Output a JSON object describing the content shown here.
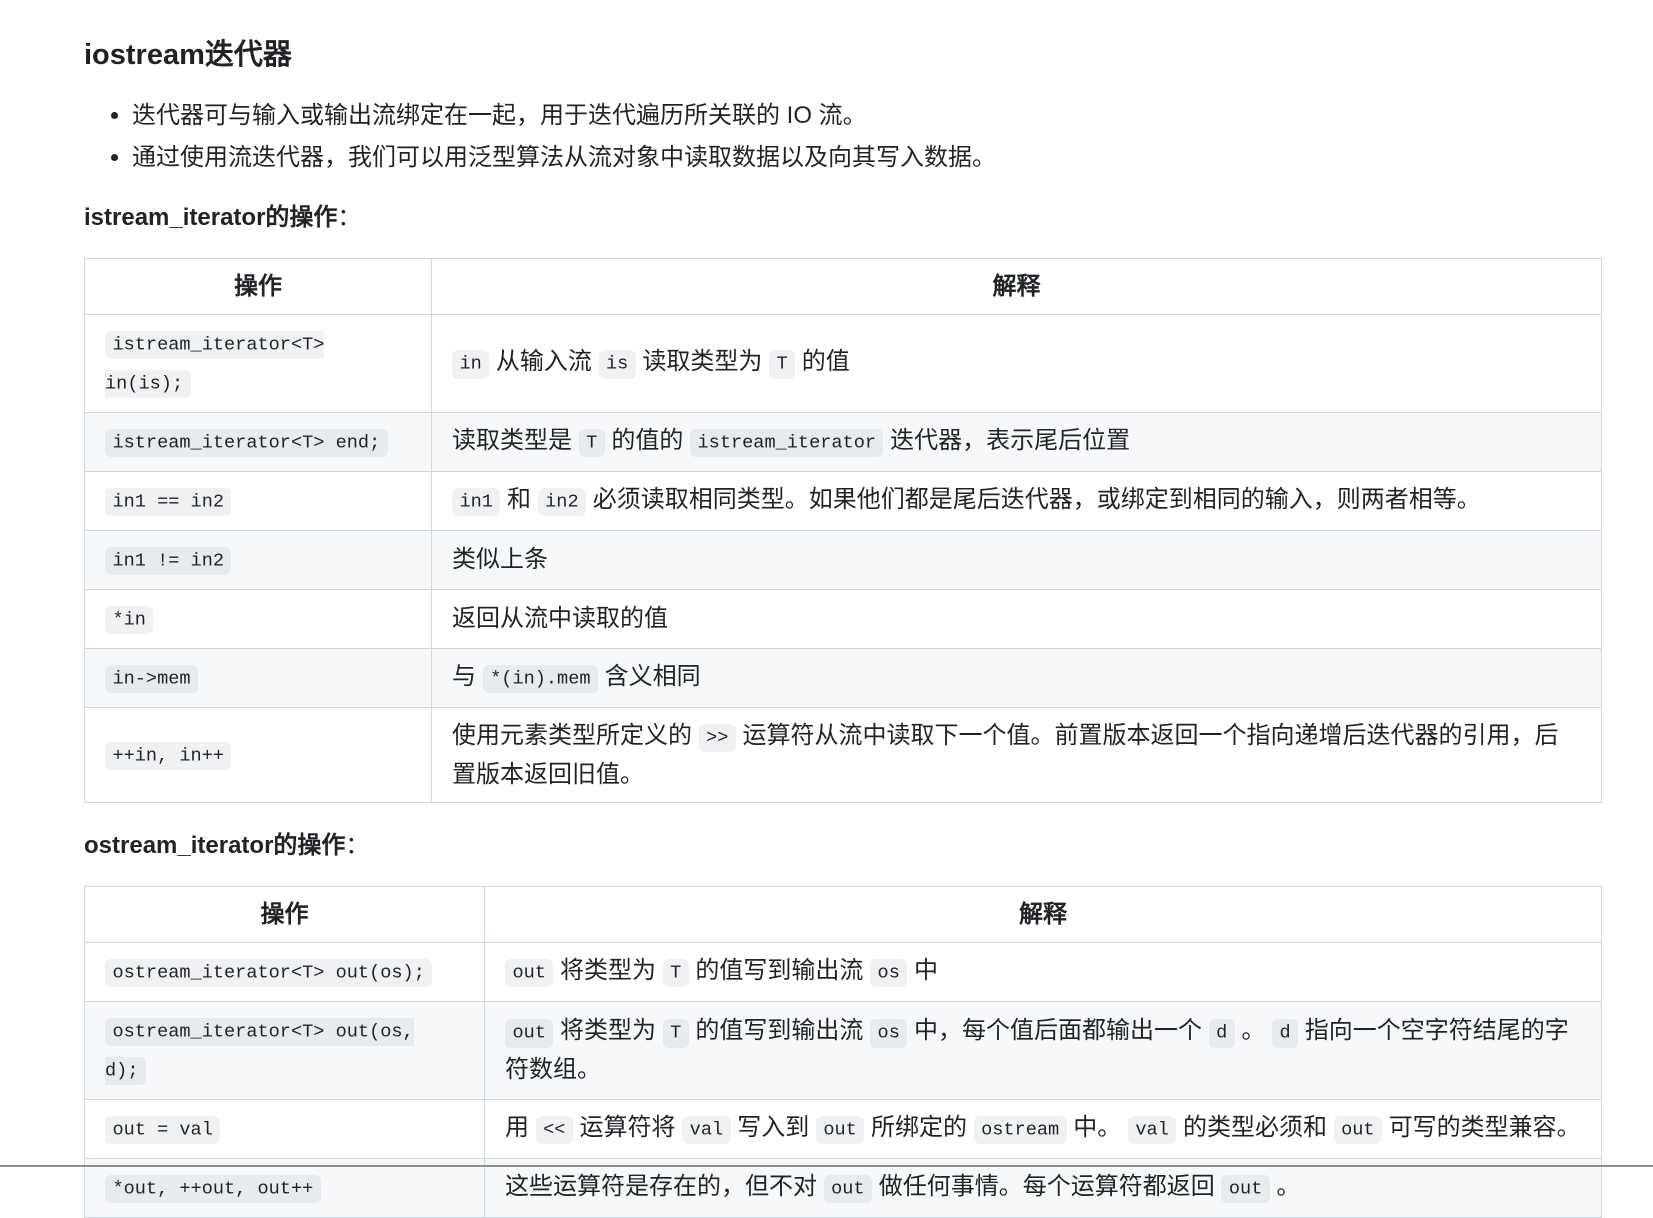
{
  "heading": "iostream迭代器",
  "bullets": [
    "迭代器可与输入或输出流绑定在一起，用于迭代遍历所关联的 IO 流。",
    "通过使用流迭代器，我们可以用泛型算法从流对象中读取数据以及向其写入数据。"
  ],
  "istream_section": {
    "title": "istream_iterator的操作",
    "title_suffix": "：",
    "headers": [
      "操作",
      "解释"
    ],
    "rows": [
      {
        "op": [
          {
            "code": "istream_iterator<T> in(is);"
          }
        ],
        "desc": [
          {
            "code": "in"
          },
          {
            "text": " 从输入流 "
          },
          {
            "code": "is"
          },
          {
            "text": " 读取类型为 "
          },
          {
            "code": "T"
          },
          {
            "text": " 的值"
          }
        ]
      },
      {
        "op": [
          {
            "code": "istream_iterator<T> end;"
          }
        ],
        "desc": [
          {
            "text": "读取类型是 "
          },
          {
            "code": "T"
          },
          {
            "text": " 的值的 "
          },
          {
            "code": "istream_iterator"
          },
          {
            "text": " 迭代器，表示尾后位置"
          }
        ]
      },
      {
        "op": [
          {
            "code": "in1 == in2"
          }
        ],
        "desc": [
          {
            "code": "in1"
          },
          {
            "text": " 和 "
          },
          {
            "code": "in2"
          },
          {
            "text": " 必须读取相同类型。如果他们都是尾后迭代器，或绑定到相同的输入，则两者相等。"
          }
        ]
      },
      {
        "op": [
          {
            "code": "in1 != in2"
          }
        ],
        "desc": [
          {
            "text": "类似上条"
          }
        ]
      },
      {
        "op": [
          {
            "code": "*in"
          }
        ],
        "desc": [
          {
            "text": "返回从流中读取的值"
          }
        ]
      },
      {
        "op": [
          {
            "code": "in->mem"
          }
        ],
        "desc": [
          {
            "text": "与 "
          },
          {
            "code": "*(in).mem"
          },
          {
            "text": " 含义相同"
          }
        ]
      },
      {
        "op": [
          {
            "code": "++in, in++"
          }
        ],
        "desc": [
          {
            "text": "使用元素类型所定义的 "
          },
          {
            "code": ">>"
          },
          {
            "text": " 运算符从流中读取下一个值。前置版本返回一个指向递增后迭代器的引用，后置版本返回旧值。"
          }
        ]
      }
    ]
  },
  "ostream_section": {
    "title": "ostream_iterator的操作",
    "title_suffix": "：",
    "headers": [
      "操作",
      "解释"
    ],
    "rows": [
      {
        "op": [
          {
            "code": "ostream_iterator<T> out(os);"
          }
        ],
        "desc": [
          {
            "code": "out"
          },
          {
            "text": " 将类型为 "
          },
          {
            "code": "T"
          },
          {
            "text": " 的值写到输出流 "
          },
          {
            "code": "os"
          },
          {
            "text": " 中"
          }
        ]
      },
      {
        "op": [
          {
            "code": "ostream_iterator<T> out(os, d);"
          }
        ],
        "desc": [
          {
            "code": "out"
          },
          {
            "text": " 将类型为 "
          },
          {
            "code": "T"
          },
          {
            "text": " 的值写到输出流 "
          },
          {
            "code": "os"
          },
          {
            "text": " 中，每个值后面都输出一个 "
          },
          {
            "code": "d"
          },
          {
            "text": " 。 "
          },
          {
            "code": "d"
          },
          {
            "text": " 指向一个空字符结尾的字符数组。"
          }
        ]
      },
      {
        "op": [
          {
            "code": "out = val"
          }
        ],
        "desc": [
          {
            "text": "用 "
          },
          {
            "code": "<<"
          },
          {
            "text": " 运算符将 "
          },
          {
            "code": "val"
          },
          {
            "text": " 写入到 "
          },
          {
            "code": "out"
          },
          {
            "text": " 所绑定的 "
          },
          {
            "code": "ostream"
          },
          {
            "text": " 中。 "
          },
          {
            "code": "val"
          },
          {
            "text": " 的类型必须和 "
          },
          {
            "code": "out"
          },
          {
            "text": " 可写的类型兼容。"
          }
        ]
      },
      {
        "op": [
          {
            "code": "*out, ++out, out++"
          }
        ],
        "desc": [
          {
            "text": "这些运算符是存在的，但不对 "
          },
          {
            "code": "out"
          },
          {
            "text": " 做任何事情。每个运算符都返回 "
          },
          {
            "code": "out"
          },
          {
            "text": " 。"
          }
        ]
      }
    ]
  }
}
